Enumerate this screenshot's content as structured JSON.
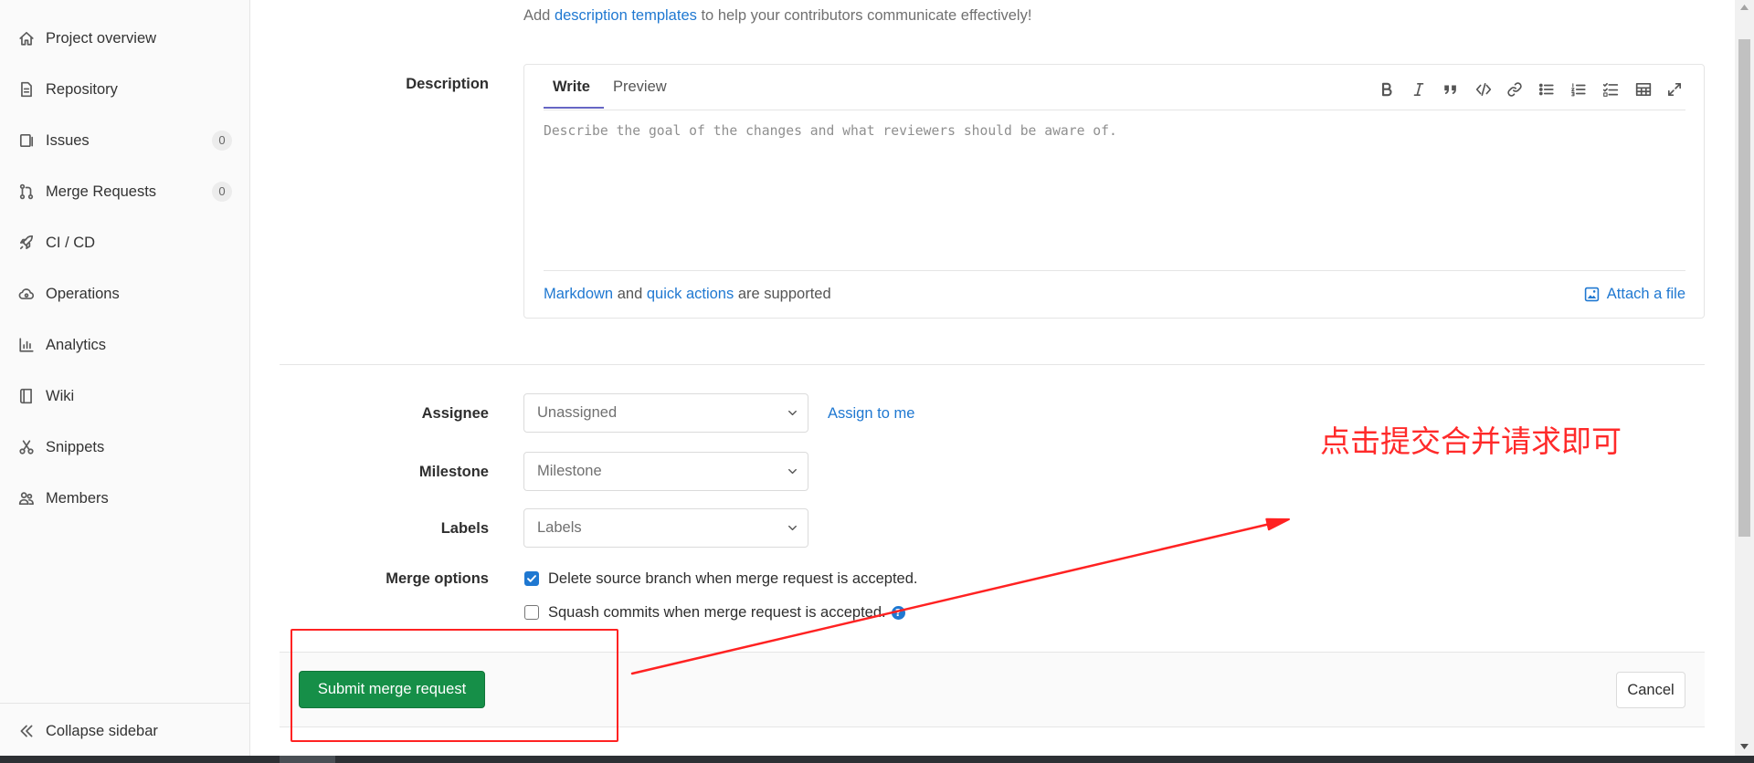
{
  "sidebar": {
    "items": [
      {
        "label": "Project overview",
        "icon": "home-icon"
      },
      {
        "label": "Repository",
        "icon": "document-icon"
      },
      {
        "label": "Issues",
        "icon": "issues-icon",
        "count": "0"
      },
      {
        "label": "Merge Requests",
        "icon": "merge-request-icon",
        "count": "0"
      },
      {
        "label": "CI / CD",
        "icon": "rocket-icon"
      },
      {
        "label": "Operations",
        "icon": "cloud-icon"
      },
      {
        "label": "Analytics",
        "icon": "chart-icon"
      },
      {
        "label": "Wiki",
        "icon": "book-icon"
      },
      {
        "label": "Snippets",
        "icon": "scissors-icon"
      },
      {
        "label": "Members",
        "icon": "users-icon"
      }
    ],
    "collapse_label": "Collapse sidebar",
    "collapse_icon": "double-chevron-left-icon"
  },
  "main": {
    "templates_hint": {
      "prefix": "Add",
      "link": "description templates",
      "suffix": "to help your contributors communicate effectively!"
    },
    "description": {
      "label": "Description",
      "tabs": [
        "Write",
        "Preview"
      ],
      "active_tab_index": 0,
      "toolbar": [
        "bold-icon",
        "italic-icon",
        "quote-icon",
        "code-icon",
        "link-icon",
        "bullet-list-icon",
        "numbered-list-icon",
        "task-list-icon",
        "table-icon",
        "fullscreen-icon"
      ],
      "placeholder": "Describe the goal of the changes and what reviewers should be aware of.",
      "footer": {
        "markdown": "Markdown",
        "and": "and",
        "quick_actions": "quick actions",
        "suffix": "are supported",
        "attach": "Attach a file"
      }
    },
    "assignee": {
      "label": "Assignee",
      "value": "Unassigned",
      "assign_to_me": "Assign to me"
    },
    "milestone": {
      "label": "Milestone",
      "value": "Milestone"
    },
    "labels": {
      "label": "Labels",
      "value": "Labels"
    },
    "merge_options": {
      "label": "Merge options",
      "options": [
        {
          "label": "Delete source branch when merge request is accepted.",
          "checked": true
        },
        {
          "label": "Squash commits when merge request is accepted.",
          "checked": false
        }
      ]
    },
    "actions": {
      "submit": "Submit merge request",
      "cancel": "Cancel"
    }
  },
  "annotation": {
    "text": "点击提交合并请求即可",
    "color": "#ff2a2a"
  },
  "colors": {
    "link": "#1f78d1",
    "submit_green": "#168f48",
    "tab_underline": "#6666c4",
    "sidebar_bg": "#fafafa"
  }
}
